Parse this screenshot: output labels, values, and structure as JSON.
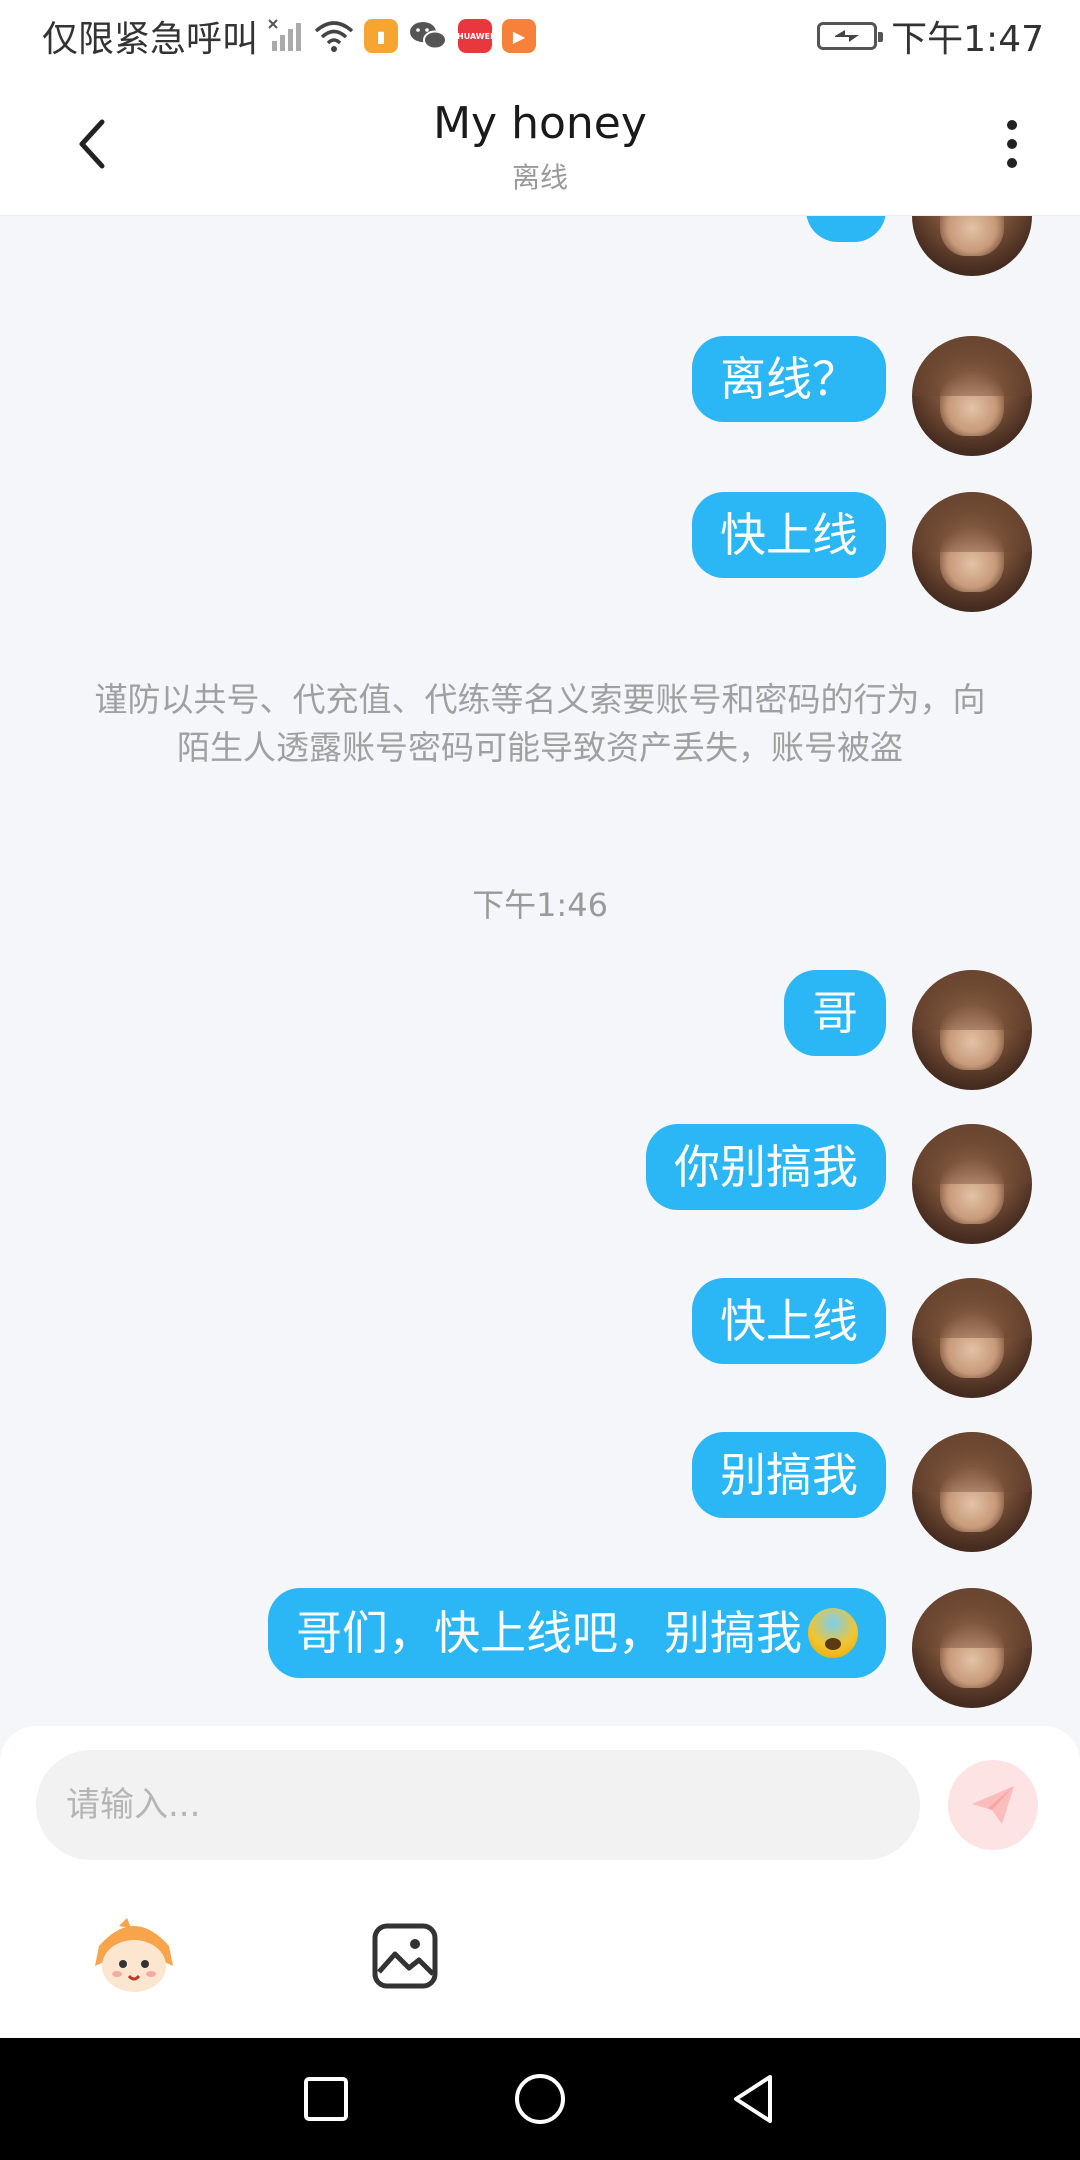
{
  "status_bar": {
    "carrier_text": "仅限紧急呼叫",
    "time": "下午1:47",
    "icons": [
      "no-sim-signal-icon",
      "wifi-icon",
      "files-app-icon",
      "wechat-icon",
      "huawei-appgallery-icon",
      "video-app-icon",
      "battery-charging-icon"
    ],
    "huawei_label": "HUAWEI"
  },
  "header": {
    "title": "My honey",
    "subtitle": "离线",
    "back_icon": "chevron-left-icon",
    "more_icon": "more-vertical-icon"
  },
  "messages_top": [
    {
      "text": "?"
    },
    {
      "text": "离线？"
    },
    {
      "text": "快上线"
    }
  ],
  "notice": "谨防以共号、代充值、代练等名义索要账号和密码的行为，向陌生人透露账号密码可能导致资产丢失，账号被盗",
  "timestamp": "下午1:46",
  "messages_bottom": [
    {
      "text": "哥"
    },
    {
      "text": "你别搞我"
    },
    {
      "text": "快上线"
    },
    {
      "text": "别搞我"
    },
    {
      "text": "哥们，快上线吧，别搞我",
      "emoji": "anxious-face-emoji"
    }
  ],
  "input": {
    "placeholder": "请输入...",
    "value": "",
    "send_icon": "send-plane-icon",
    "send_color": "#fde3e3"
  },
  "toolbar": {
    "tools": [
      "mascot-sticker-icon",
      "image-icon"
    ]
  },
  "nav_bar": {
    "buttons": [
      "recents-square-icon",
      "home-circle-icon",
      "back-triangle-icon"
    ]
  },
  "colors": {
    "bubble": "#2bb6f6",
    "background": "#f4f6fa",
    "notice_text": "#a0a0a0"
  }
}
